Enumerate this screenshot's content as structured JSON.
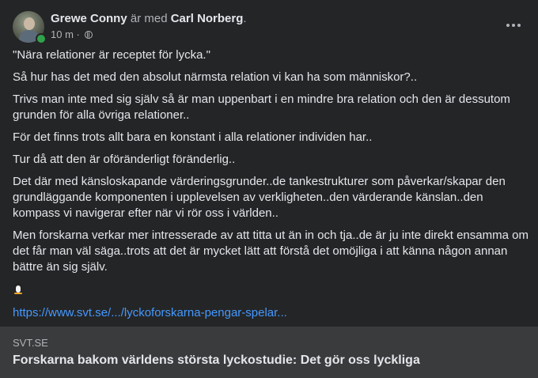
{
  "post": {
    "author": "Grewe Conny",
    "with_text": "är med",
    "tagged": "Carl Norberg",
    "tail": ".",
    "time": "10 m",
    "separator": "·",
    "menu_icon": "more-horizontal-icon",
    "privacy_icon": "globe-icon",
    "online_color": "#31a24c"
  },
  "body": {
    "paragraphs": [
      "\"Nära relationer är receptet för lycka.\"",
      "Så hur has det med den absolut närmsta relation vi kan ha som människor?..",
      "Trivs man inte med sig själv så är man uppenbart i en mindre bra relation och den är dessutom grunden för alla övriga relationer..",
      "För det finns trots allt bara en konstant i alla relationer individen har..",
      "Tur då att den är oföränderligt föränderlig..",
      "Det där med känsloskapande värderingsgrunder..de tankestrukturer som påverkar/skapar den grundläggande komponenten i upplevelsen av verkligheten..den värderande känslan..den kompass vi navigerar efter när vi rör oss i världen..",
      "Men forskarna verkar mer intresserade av att titta ut än in och tja..de är ju inte direkt ensamma om det får man väl säga..trots att det är mycket lätt att förstå det omöjliga i att känna någon annan bättre än sig själv."
    ],
    "emoji": "penguin-emoji",
    "link": "https://www.svt.se/.../lyckoforskarna-pengar-spelar..."
  },
  "preview": {
    "domain": "SVT.SE",
    "headline": "Forskarna bakom världens största lyckostudie: Det gör oss lyckliga"
  }
}
